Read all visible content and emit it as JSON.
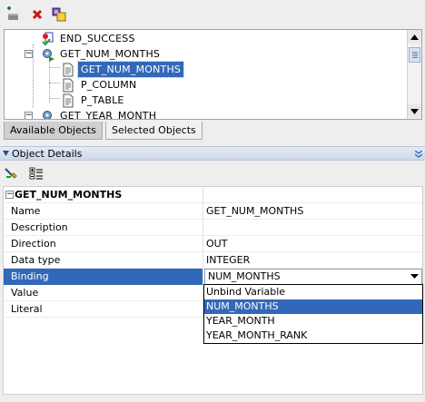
{
  "toolbar": {
    "buttons": [
      {
        "name": "add-object-button",
        "icon": "add-plus-icon"
      },
      {
        "name": "delete-button",
        "icon": "red-x-icon"
      },
      {
        "name": "variables-button",
        "icon": "object-grid-icon"
      }
    ]
  },
  "tree": {
    "items": [
      {
        "label": "END_SUCCESS",
        "icon": "end-success-icon"
      },
      {
        "label": "GET_NUM_MONTHS",
        "icon": "procedure-icon"
      },
      {
        "label": "GET_NUM_MONTHS",
        "icon": "document-icon"
      },
      {
        "label": "P_COLUMN",
        "icon": "document-icon"
      },
      {
        "label": "P_TABLE",
        "icon": "document-icon"
      },
      {
        "label": "GET_YEAR_MONTH",
        "icon": "procedure-icon"
      }
    ]
  },
  "tabs": {
    "available": "Available Objects",
    "selected": "Selected Objects"
  },
  "panel": {
    "title": "Object Details"
  },
  "properties": {
    "section": "GET_NUM_MONTHS",
    "rows": [
      {
        "name": "Name",
        "value": "GET_NUM_MONTHS"
      },
      {
        "name": "Description",
        "value": ""
      },
      {
        "name": "Direction",
        "value": "OUT"
      },
      {
        "name": "Data type",
        "value": "INTEGER"
      },
      {
        "name": "Binding",
        "value": "NUM_MONTHS"
      },
      {
        "name": "Value",
        "value": ""
      },
      {
        "name": "Literal",
        "value": ""
      }
    ]
  },
  "dropdown": {
    "options": [
      "Unbind Variable",
      "NUM_MONTHS",
      "YEAR_MONTH",
      "YEAR_MONTH_RANK"
    ],
    "selected": "NUM_MONTHS"
  },
  "colors": {
    "selection": "#3268b8",
    "panel_header": "#cdd9ea"
  }
}
